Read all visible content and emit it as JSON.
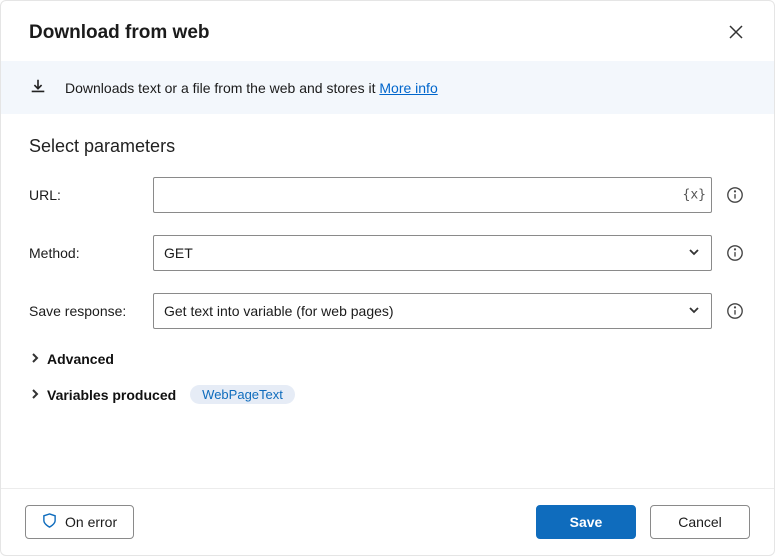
{
  "title": "Download from web",
  "banner": {
    "text": "Downloads text or a file from the web and stores it",
    "link_label": "More info"
  },
  "section_heading": "Select parameters",
  "fields": {
    "url": {
      "label": "URL:",
      "value": "",
      "var_button": "{x}"
    },
    "method": {
      "label": "Method:",
      "value": "GET"
    },
    "save_response": {
      "label": "Save response:",
      "value": "Get text into variable (for web pages)"
    }
  },
  "expanders": {
    "advanced": "Advanced",
    "variables_produced": "Variables produced",
    "variable_chip": "WebPageText"
  },
  "footer": {
    "on_error": "On error",
    "save": "Save",
    "cancel": "Cancel"
  }
}
